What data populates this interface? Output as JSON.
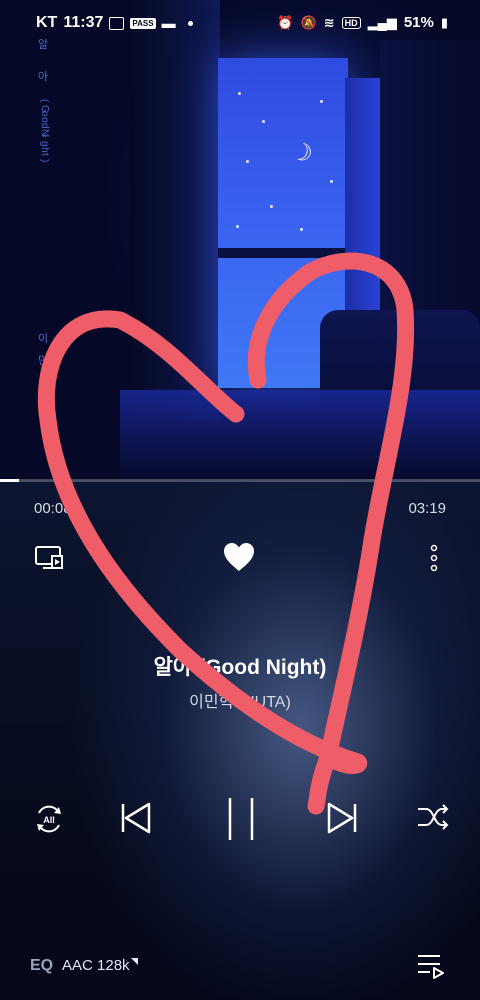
{
  "status_bar": {
    "carrier": "KT",
    "time": "11:37",
    "pass_badge": "PASS",
    "hd_badge": "HD",
    "battery": "51%",
    "left_icons": [
      "image-icon",
      "pass-icon",
      "message-icon",
      "dot-icon"
    ],
    "right_icons": [
      "alarm-icon",
      "mute-icon",
      "wifi-icon",
      "hd-voice-icon",
      "signal-icon",
      "battery-icon"
    ]
  },
  "album_lyrics": {
    "title_line_1": "알",
    "title_line_2": "아",
    "title_line_3": "( Good Night )",
    "artist_line_1": "이",
    "artist_line_2": "민"
  },
  "progress": {
    "elapsed": "00:08",
    "total": "03:19",
    "fraction": 0.04
  },
  "actions": {
    "liked": true,
    "icons": [
      "cast-icon",
      "heart-icon",
      "more-icon"
    ]
  },
  "track": {
    "title": "알아 (Good Night)",
    "artist": "이민혁 (HUTA)"
  },
  "controls": {
    "repeat_mode": "All",
    "icons": [
      "repeat-all-icon",
      "previous-icon",
      "pause-icon",
      "next-icon",
      "shuffle-icon"
    ]
  },
  "bottom_bar": {
    "eq_label": "EQ",
    "codec": "AAC 128k",
    "playlist_icon": "playlist-icon"
  },
  "colors": {
    "accent": "#ffffff",
    "doodle": "#ef5e68",
    "background": "#05081a"
  }
}
